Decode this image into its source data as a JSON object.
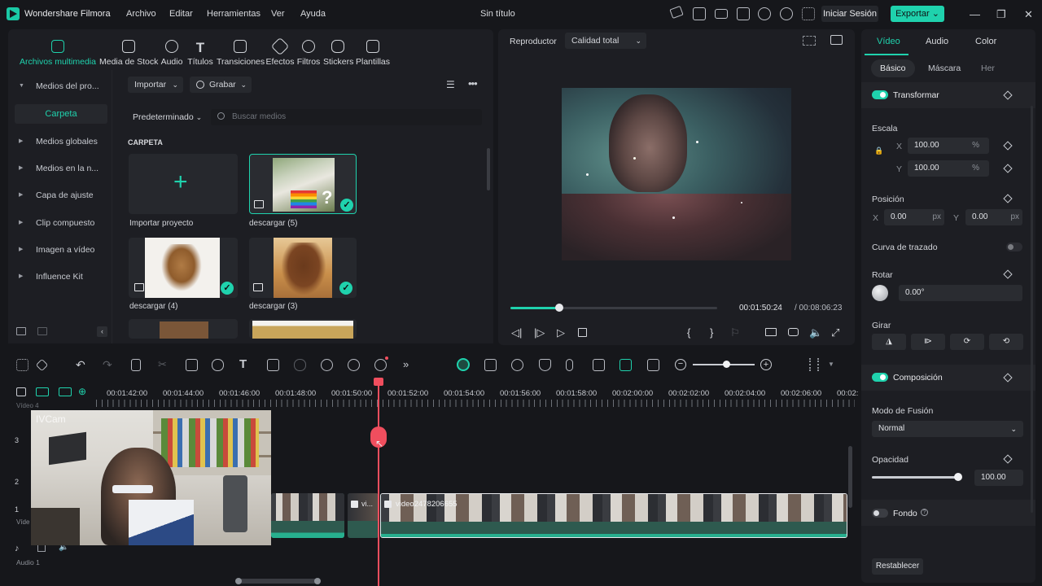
{
  "app": {
    "name": "Wondershare Filmora",
    "doc_title": "Sin título",
    "sign_in": "Iniciar Sesión",
    "export": "Exportar"
  },
  "menu": [
    "Archivo",
    "Editar",
    "Herramientas",
    "Ver",
    "Ayuda"
  ],
  "media_tabs": [
    {
      "label": "Archivos multimedia",
      "active": true
    },
    {
      "label": "Media de Stock"
    },
    {
      "label": "Audio"
    },
    {
      "label": "Títulos"
    },
    {
      "label": "Transiciones"
    },
    {
      "label": "Efectos"
    },
    {
      "label": "Filtros"
    },
    {
      "label": "Stickers"
    },
    {
      "label": "Plantillas"
    }
  ],
  "sidebar": {
    "items": [
      {
        "label": "Medios del pro..."
      },
      {
        "label": "Carpeta"
      },
      {
        "label": "Medios globales"
      },
      {
        "label": "Medios en la n..."
      },
      {
        "label": "Capa de ajuste"
      },
      {
        "label": "Clip compuesto"
      },
      {
        "label": "Imagen a vídeo"
      },
      {
        "label": "Influence Kit"
      }
    ]
  },
  "media": {
    "import": "Importar",
    "record": "Grabar",
    "sort": "Predeterminado",
    "search_placeholder": "Buscar medios",
    "folder_heading": "CARPETA",
    "tiles": [
      {
        "label": "Importar proyecto"
      },
      {
        "label": "descargar (5)"
      },
      {
        "label": "descargar (4)"
      },
      {
        "label": "descargar (3)"
      }
    ]
  },
  "player": {
    "label": "Reproductor",
    "quality": "Calidad total",
    "current_time": "00:01:50:24",
    "total_time": "/ 00:08:06:23",
    "progress": 0.235
  },
  "properties": {
    "tabs": [
      "Vídeo",
      "Audio",
      "Color"
    ],
    "subtabs": [
      "Básico",
      "Máscara",
      "Her"
    ],
    "transform": "Transformar",
    "scale_label": "Escala",
    "scale_x_label": "X",
    "scale_x": "100.00",
    "scale_y_label": "Y",
    "scale_y": "100.00",
    "percent": "%",
    "position_label": "Posición",
    "pos_x_label": "X",
    "pos_x": "0.00",
    "pos_y_label": "Y",
    "pos_y": "0.00",
    "px": "px",
    "path_curve": "Curva de trazado",
    "rotate_label": "Rotar",
    "rotate_value": "0.00°",
    "flip_label": "Girar",
    "composition": "Composición",
    "blend_label": "Modo de Fusión",
    "blend_value": "Normal",
    "opacity_label": "Opacidad",
    "opacity_value": "100.00",
    "background": "Fondo",
    "reset": "Restablecer"
  },
  "timeline": {
    "ruler": [
      "00:01:42:00",
      "00:01:44:00",
      "00:01:46:00",
      "00:01:48:00",
      "00:01:50:00",
      "00:01:52:00",
      "00:01:54:00",
      "00:01:56:00",
      "00:01:58:00",
      "00:02:00:00",
      "00:02:02:00",
      "00:02:04:00",
      "00:02:06:00",
      "00:02:"
    ],
    "video4_label": "Vídeo 4",
    "track_nums": [
      "3",
      "2",
      "1"
    ],
    "video1_label": "Víde",
    "audio1_label": "Audio 1",
    "clip_short": "vi...",
    "clip_main": "video2478206655",
    "cam_text": "IVCam"
  }
}
